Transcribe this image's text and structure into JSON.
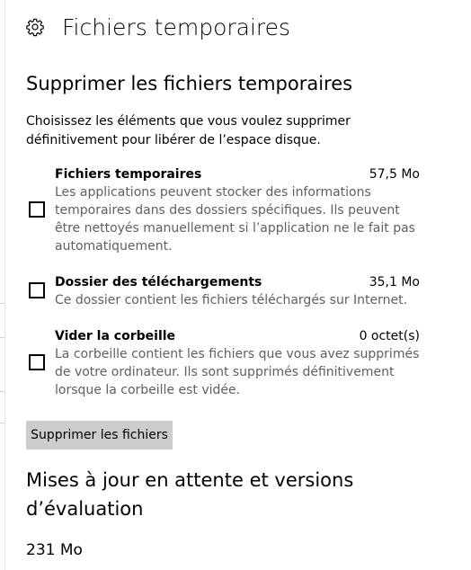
{
  "header": {
    "icon": "gear-icon",
    "title": "Fichiers temporaires"
  },
  "section": {
    "title": "Supprimer les fichiers temporaires",
    "intro": "Choisissez les éléments que vous voulez supprimer définitivement pour libérer de l’espace disque."
  },
  "items": [
    {
      "name": "Fichiers temporaires",
      "size": "57,5 Mo",
      "description": "Les applications peuvent stocker des informations temporaires dans des dossiers spécifiques. Ils peuvent être nettoyés manuellement si l’application ne le fait pas automatiquement.",
      "checked": false
    },
    {
      "name": "Dossier des téléchargements",
      "size": "35,1 Mo",
      "description": "Ce dossier contient les fichiers téléchargés sur Internet.",
      "checked": false
    },
    {
      "name": "Vider la corbeille",
      "size": "0 octet(s)",
      "description": "La corbeille contient les fichiers que vous avez supprimés de votre ordinateur. Ils sont supprimés définitivement lorsque la corbeille est vidée.",
      "checked": false
    }
  ],
  "actions": {
    "delete_label": "Supprimer les fichiers"
  },
  "updates": {
    "title": "Mises à jour en attente et versions d’évaluation",
    "size": "231 Mo"
  },
  "colors": {
    "background": "#ffffff",
    "description_text": "#5f5f5f",
    "button_background": "#cccccc"
  }
}
